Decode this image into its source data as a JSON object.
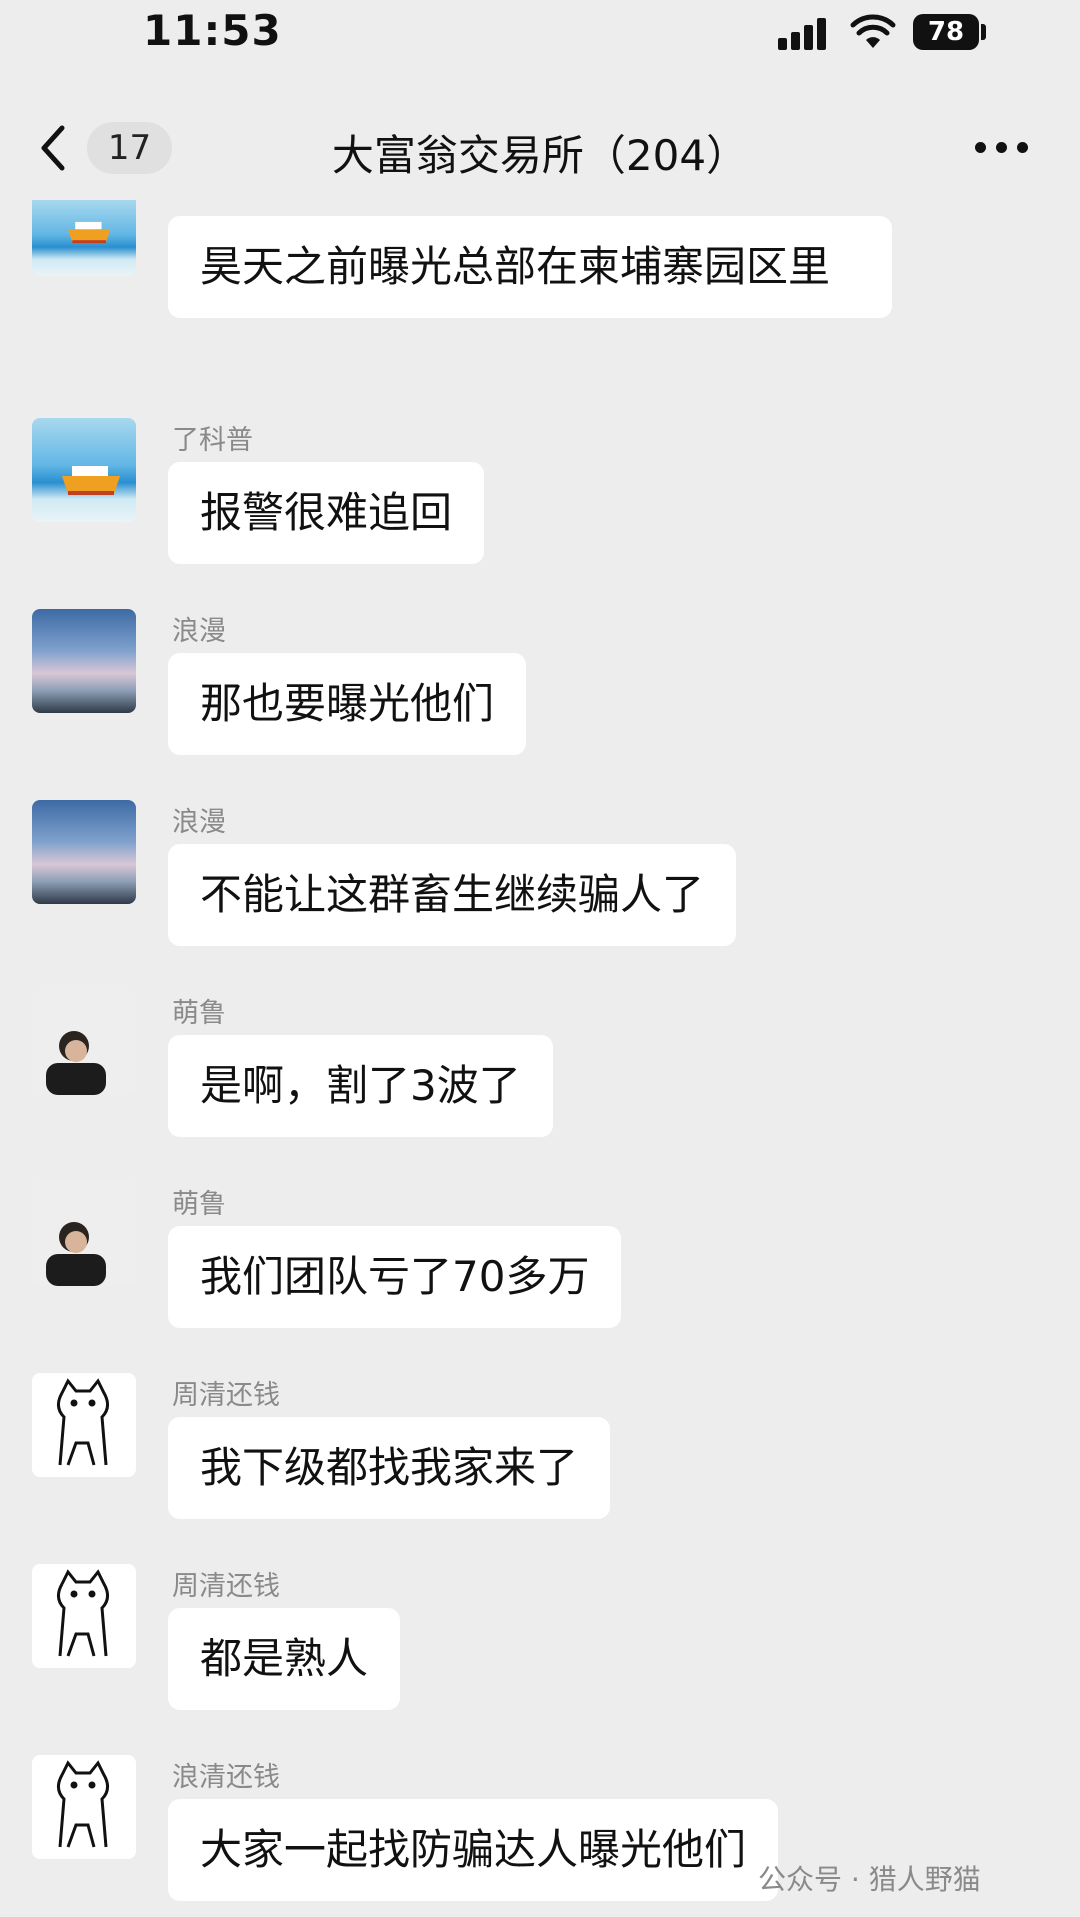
{
  "status_bar": {
    "time": "11:53",
    "battery": "78"
  },
  "nav": {
    "back_count": "17",
    "title": "大富翁交易所（204）"
  },
  "messages": [
    {
      "sender": "",
      "avatar": "boat-avatar",
      "text": "昊天之前曝光总部在柬埔寨园区里"
    },
    {
      "sender": "了科普",
      "avatar": "boat-avatar",
      "text": "报警很难追回"
    },
    {
      "sender": "浪漫",
      "avatar": "sky-avatar",
      "text": "那也要曝光他们"
    },
    {
      "sender": "浪漫",
      "avatar": "sky-avatar",
      "text": "不能让这群畜生继续骗人了"
    },
    {
      "sender": "萌鲁",
      "avatar": "man-avatar",
      "text": "是啊，割了3波了"
    },
    {
      "sender": "萌鲁",
      "avatar": "man-avatar",
      "text": "我们团队亏了70多万"
    },
    {
      "sender": "周清还钱",
      "avatar": "cat-avatar",
      "text": "我下级都找我家来了"
    },
    {
      "sender": "周清还钱",
      "avatar": "cat-avatar",
      "text": "都是熟人"
    },
    {
      "sender": "浪清还钱",
      "avatar": "cat-avatar",
      "text": "大家一起找防骗达人曝光他们"
    }
  ],
  "watermark": "公众号 · 猎人野猫"
}
